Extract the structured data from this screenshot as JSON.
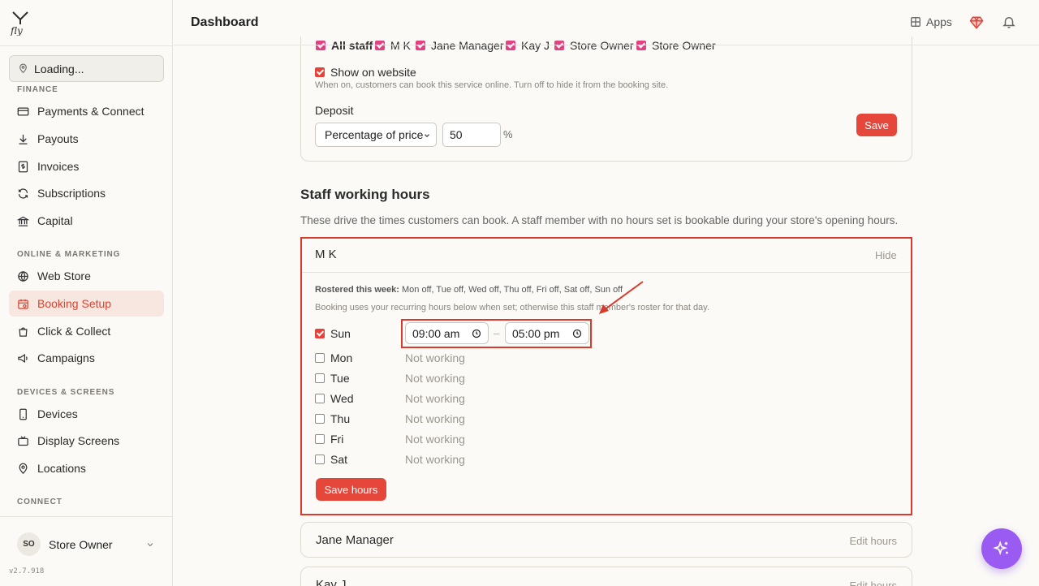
{
  "header": {
    "title": "Dashboard",
    "apps_label": "Apps"
  },
  "sidebar": {
    "location": "Loading...",
    "sections": {
      "finance": "FINANCE",
      "online": "ONLINE & MARKETING",
      "devices": "DEVICES & SCREENS",
      "connect": "CONNECT"
    },
    "items": {
      "payments": "Payments & Connect",
      "payouts": "Payouts",
      "invoices": "Invoices",
      "subscriptions": "Subscriptions",
      "capital": "Capital",
      "webstore": "Web Store",
      "booking": "Booking Setup",
      "click": "Click & Collect",
      "campaigns": "Campaigns",
      "devices": "Devices",
      "display": "Display Screens",
      "locations": "Locations"
    },
    "user": {
      "initials": "SO",
      "name": "Store Owner"
    },
    "version": "v2.7.918"
  },
  "service_card": {
    "staff_options": [
      "All staff",
      "M K",
      "Jane Manager",
      "Kay J",
      "Store Owner",
      "Store Owner"
    ],
    "show_on_website_label": "Show on website",
    "show_on_website_help": "When on, customers can book this service online. Turn off to hide it from the booking site.",
    "deposit_label": "Deposit",
    "deposit_type": "Percentage of price",
    "deposit_value": "50",
    "deposit_unit": "%",
    "save_label": "Save"
  },
  "staff_hours": {
    "title": "Staff working hours",
    "description": "These drive the times customers can book. A staff member with no hours set is bookable during your store's opening hours.",
    "expanded": {
      "name": "M K",
      "hide_label": "Hide",
      "rostered_prefix": "Rostered this week:",
      "rostered_value": "Mon off, Tue off, Wed off, Thu off, Fri off, Sat off, Sun off",
      "note": "Booking uses your recurring hours below when set; otherwise this staff member's roster for that day.",
      "days": [
        {
          "label": "Sun",
          "checked": true,
          "start": "09:00 am",
          "end": "05:00 pm"
        },
        {
          "label": "Mon",
          "checked": false,
          "status": "Not working"
        },
        {
          "label": "Tue",
          "checked": false,
          "status": "Not working"
        },
        {
          "label": "Wed",
          "checked": false,
          "status": "Not working"
        },
        {
          "label": "Thu",
          "checked": false,
          "status": "Not working"
        },
        {
          "label": "Fri",
          "checked": false,
          "status": "Not working"
        },
        {
          "label": "Sat",
          "checked": false,
          "status": "Not working"
        }
      ],
      "dash": "–",
      "save_hours_label": "Save hours"
    },
    "collapsed": [
      {
        "name": "Jane Manager",
        "action": "Edit hours"
      },
      {
        "name": "Kay J",
        "action": "Edit hours"
      }
    ]
  },
  "colors": {
    "accent": "#e5483b",
    "checkbox_pink": "#e0437f",
    "highlight": "#d93a2e",
    "fab": "#9a5bf2"
  }
}
